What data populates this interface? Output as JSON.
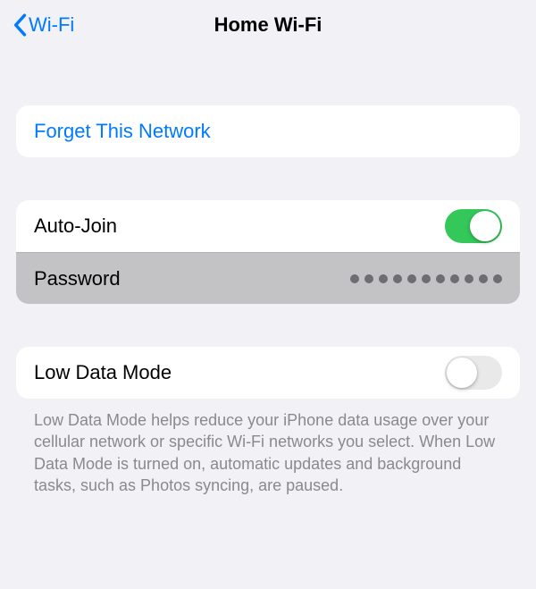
{
  "nav": {
    "back_label": "Wi-Fi",
    "title": "Home Wi-Fi"
  },
  "forget": {
    "label": "Forget This Network"
  },
  "auto_join": {
    "label": "Auto-Join",
    "on": true
  },
  "password": {
    "label": "Password",
    "mask_length": 11
  },
  "low_data": {
    "label": "Low Data Mode",
    "on": false,
    "footer": "Low Data Mode helps reduce your iPhone data usage over your cellular network or specific Wi-Fi networks you select. When Low Data Mode is turned on, automatic updates and background tasks, such as Photos syncing, are paused."
  }
}
